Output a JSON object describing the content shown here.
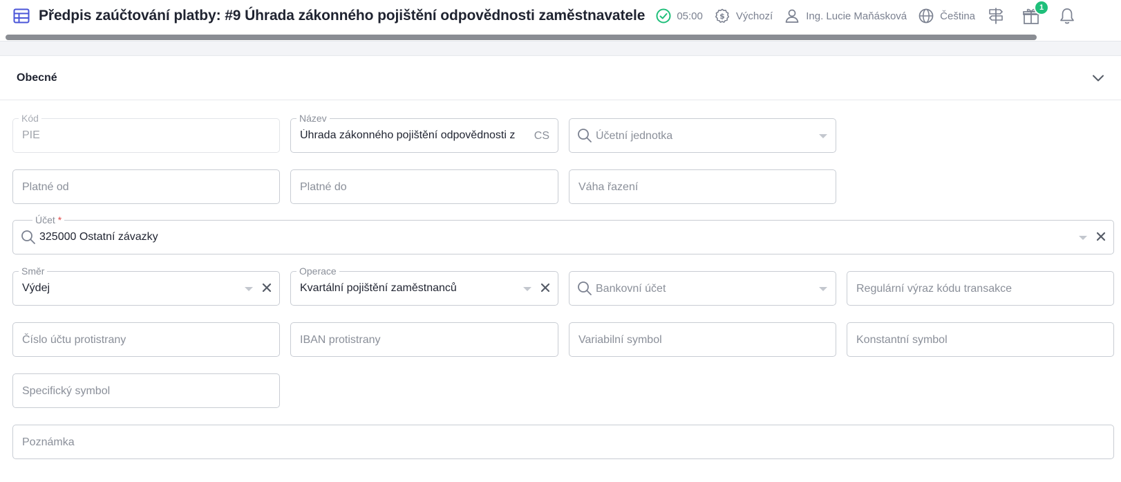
{
  "header": {
    "title": "Předpis zaúčtování platby: #9 Úhrada zákonného pojištění odpovědnosti zaměstnavatele",
    "timer": "05:00",
    "currency_profile": "Výchozí",
    "user": "Ing. Lucie Maňásková",
    "language": "Čeština",
    "gift_badge": "1",
    "colors": {
      "accent": "#4a55d8",
      "success": "#1fbf7a"
    }
  },
  "section": {
    "title": "Obecné"
  },
  "fields": {
    "kod": {
      "label": "Kód",
      "value": "PIE"
    },
    "nazev": {
      "label": "Název",
      "value": "Úhrada zákonného pojištění odpovědnosti z",
      "suffix": "CS"
    },
    "ucetni_jednotka": {
      "placeholder": "Účetní jednotka"
    },
    "platne_od": {
      "placeholder": "Platné od"
    },
    "platne_do": {
      "placeholder": "Platné do"
    },
    "vaha_razeni": {
      "placeholder": "Váha řazení"
    },
    "ucet": {
      "label": "Účet",
      "required_mark": "*",
      "value": "325000 Ostatní závazky"
    },
    "smer": {
      "label": "Směr",
      "value": "Výdej"
    },
    "operace": {
      "label": "Operace",
      "value": "Kvartální pojištění zaměstnanců"
    },
    "bankovni_ucet": {
      "placeholder": "Bankovní účet"
    },
    "regex_kodu": {
      "placeholder": "Regulární výraz kódu transakce"
    },
    "cislo_uctu_protistrany": {
      "placeholder": "Číslo účtu protistrany"
    },
    "iban_protistrany": {
      "placeholder": "IBAN protistrany"
    },
    "variabilni_symbol": {
      "placeholder": "Variabilní symbol"
    },
    "konstantni_symbol": {
      "placeholder": "Konstantní symbol"
    },
    "specificky_symbol": {
      "placeholder": "Specifický symbol"
    },
    "poznamka": {
      "placeholder": "Poznámka"
    }
  }
}
